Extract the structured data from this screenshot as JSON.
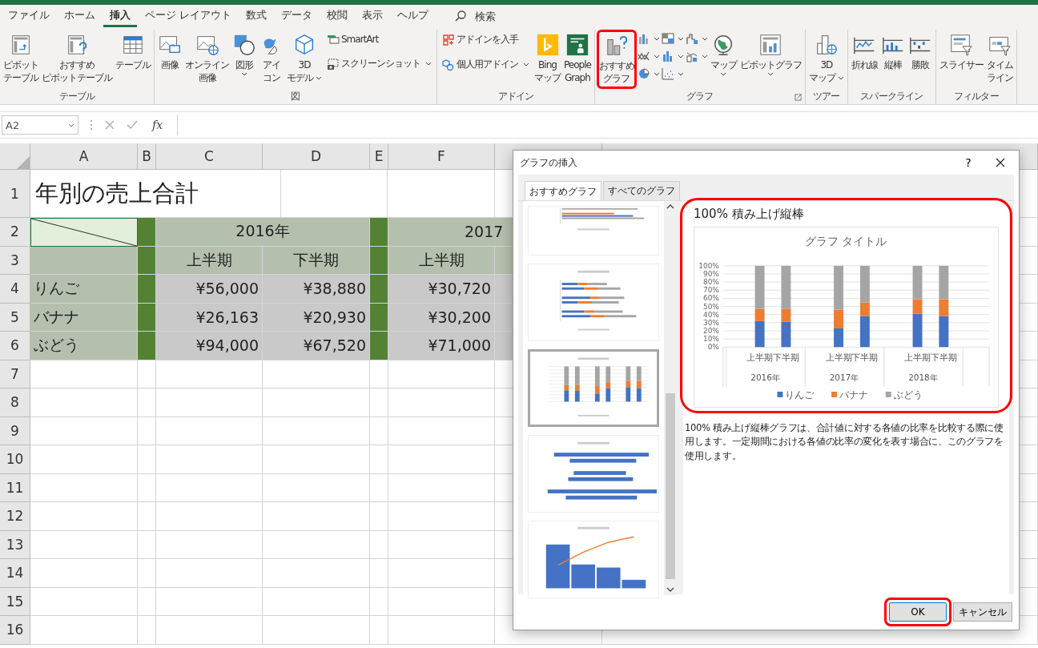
{
  "menu_tabs": [
    {
      "label": "ファイル",
      "selected": false
    },
    {
      "label": "ホーム",
      "selected": false
    },
    {
      "label": "挿入",
      "selected": true
    },
    {
      "label": "ページ レイアウト",
      "selected": false
    },
    {
      "label": "数式",
      "selected": false
    },
    {
      "label": "データ",
      "selected": false
    },
    {
      "label": "校閲",
      "selected": false
    },
    {
      "label": "表示",
      "selected": false
    },
    {
      "label": "ヘルプ",
      "selected": false
    }
  ],
  "search": {
    "placeholder": "検索"
  },
  "ribbon_groups": [
    {
      "label": "テーブル",
      "launcher": false,
      "buttons": [
        {
          "kind": "large",
          "lines": [
            "ピボット",
            "テーブル"
          ],
          "dropdown": false
        },
        {
          "kind": "large",
          "lines": [
            "おすすめ",
            "ピボットテーブル"
          ],
          "dropdown": false
        },
        {
          "kind": "large",
          "lines": [
            "テーブル"
          ],
          "dropdown": false
        }
      ]
    },
    {
      "label": "図",
      "launcher": false,
      "buttons": [
        {
          "kind": "large",
          "lines": [
            "画像"
          ],
          "dropdown": false
        },
        {
          "kind": "large",
          "lines": [
            "オンライン",
            "画像"
          ],
          "dropdown": false
        },
        {
          "kind": "large",
          "lines": [
            "図形"
          ],
          "dropdown": true
        },
        {
          "kind": "large",
          "lines": [
            "アイ",
            "コン"
          ],
          "dropdown": false
        },
        {
          "kind": "large",
          "lines": [
            "3D",
            "モデル"
          ],
          "dropdown": true
        },
        {
          "kind": "small",
          "lines": [
            "SmartArt"
          ],
          "dropdown": false
        },
        {
          "kind": "small",
          "lines": [
            "スクリーンショット"
          ],
          "dropdown": true
        }
      ]
    },
    {
      "label": "アドイン",
      "launcher": false,
      "buttons": [
        {
          "kind": "small",
          "lines": [
            "アドインを入手"
          ],
          "dropdown": false
        },
        {
          "kind": "small",
          "lines": [
            "個人用アドイン"
          ],
          "dropdown": true
        },
        {
          "kind": "large",
          "lines": [
            "Bing",
            "マップ"
          ],
          "dropdown": false
        },
        {
          "kind": "large",
          "lines": [
            "People",
            "Graph"
          ],
          "dropdown": false
        }
      ]
    },
    {
      "label": "グラフ",
      "launcher": true,
      "buttons": [
        {
          "kind": "large",
          "lines": [
            "おすすめ",
            "グラフ"
          ],
          "dropdown": false,
          "highlighted": true
        },
        {
          "kind": "icon",
          "dropdown": true
        },
        {
          "kind": "icon",
          "dropdown": true
        },
        {
          "kind": "icon",
          "dropdown": true
        },
        {
          "kind": "icon",
          "dropdown": true
        },
        {
          "kind": "icon",
          "dropdown": true
        },
        {
          "kind": "icon",
          "dropdown": true
        },
        {
          "kind": "icon",
          "dropdown": true
        },
        {
          "kind": "icon",
          "dropdown": true
        },
        {
          "kind": "large",
          "lines": [
            "マップ"
          ],
          "dropdown": true
        },
        {
          "kind": "large",
          "lines": [
            "ピボットグラフ"
          ],
          "dropdown": true
        }
      ]
    },
    {
      "label": "ツアー",
      "launcher": false,
      "buttons": [
        {
          "kind": "large",
          "lines": [
            "3D",
            "マップ"
          ],
          "dropdown": true
        }
      ]
    },
    {
      "label": "スパークライン",
      "launcher": false,
      "buttons": [
        {
          "kind": "large",
          "lines": [
            "折れ線"
          ],
          "dropdown": false
        },
        {
          "kind": "large",
          "lines": [
            "縦棒"
          ],
          "dropdown": false
        },
        {
          "kind": "large",
          "lines": [
            "勝敗"
          ],
          "dropdown": false
        }
      ]
    },
    {
      "label": "フィルター",
      "launcher": false,
      "buttons": [
        {
          "kind": "large",
          "lines": [
            "スライサー"
          ],
          "dropdown": false
        },
        {
          "kind": "large",
          "lines": [
            "タイム",
            "ライン"
          ],
          "dropdown": false
        }
      ]
    }
  ],
  "formula_bar": {
    "name_box": "A2",
    "fx": "fx"
  },
  "sheet": {
    "column_headers": [
      "A",
      "B",
      "C",
      "D",
      "E",
      "F"
    ],
    "row_numbers": [
      "1",
      "2",
      "3",
      "4",
      "5",
      "6",
      "7",
      "8",
      "9",
      "10",
      "11",
      "12",
      "13",
      "14",
      "15",
      "16"
    ],
    "title": "年別の売上合計",
    "years": [
      "2016年",
      "2017"
    ],
    "halves": [
      "上半期",
      "下半期",
      "上半期"
    ],
    "rows": [
      {
        "name": "りんご",
        "values": [
          "¥56,000",
          "¥38,880",
          "¥30,720"
        ]
      },
      {
        "name": "バナナ",
        "values": [
          "¥26,163",
          "¥20,930",
          "¥30,200"
        ]
      },
      {
        "name": "ぶどう",
        "values": [
          "¥94,000",
          "¥67,520",
          "¥71,000"
        ]
      }
    ]
  },
  "dialog": {
    "title": "グラフの挿入",
    "help": "?",
    "tabs": [
      {
        "label": "おすすめグラフ",
        "selected": true
      },
      {
        "label": "すべてのグラフ",
        "selected": false
      }
    ],
    "thumbnails": [
      {
        "kind": "bar-clustered",
        "selected": false
      },
      {
        "kind": "bar-stacked",
        "selected": false
      },
      {
        "kind": "column-100",
        "selected": true
      },
      {
        "kind": "funnel",
        "selected": false
      },
      {
        "kind": "pareto",
        "selected": false
      }
    ],
    "preview": {
      "heading": "100% 積み上げ縦棒",
      "highlighted": true,
      "year_labels": [
        "2016年",
        "2017年",
        "2018年"
      ],
      "chart_data": {
        "type": "bar",
        "title": "グラフ タイトル",
        "stacked": true,
        "grid": true,
        "legend": "bottom",
        "categories": [
          "上半期",
          "下半期",
          "上半期",
          "下半期",
          "上半期",
          "下半期"
        ],
        "ylim": [
          0,
          100
        ],
        "yticks": [
          {
            "value": 0,
            "label": "0%"
          },
          {
            "value": 10,
            "label": "10%"
          },
          {
            "value": 20,
            "label": "20%"
          },
          {
            "value": 30,
            "label": "30%"
          },
          {
            "value": 40,
            "label": "40%"
          },
          {
            "value": 50,
            "label": "50%"
          },
          {
            "value": 60,
            "label": "60%"
          },
          {
            "value": 70,
            "label": "70%"
          },
          {
            "value": 80,
            "label": "80%"
          },
          {
            "value": 90,
            "label": "90%"
          },
          {
            "value": 100,
            "label": "100%"
          }
        ],
        "series": [
          {
            "name": "りんご",
            "color": "#4472c4",
            "values": [
              32,
              31,
              23,
              38,
              41,
              38
            ]
          },
          {
            "name": "バナナ",
            "color": "#ed7d31",
            "values": [
              15,
              16,
              23,
              17,
              18,
              21
            ]
          },
          {
            "name": "ぶどう",
            "color": "#a5a5a5",
            "values": [
              53,
              53,
              54,
              45,
              41,
              41
            ]
          }
        ]
      }
    },
    "description": "100% 積み上げ縦棒グラフは、合計値に対する各値の比率を比較する際に使用します。一定期間における各値の比率の変化を表す場合に、このグラフを使用します。",
    "buttons": [
      {
        "label": "OK",
        "highlighted": true
      },
      {
        "label": "キャンセル",
        "highlighted": false
      }
    ]
  }
}
